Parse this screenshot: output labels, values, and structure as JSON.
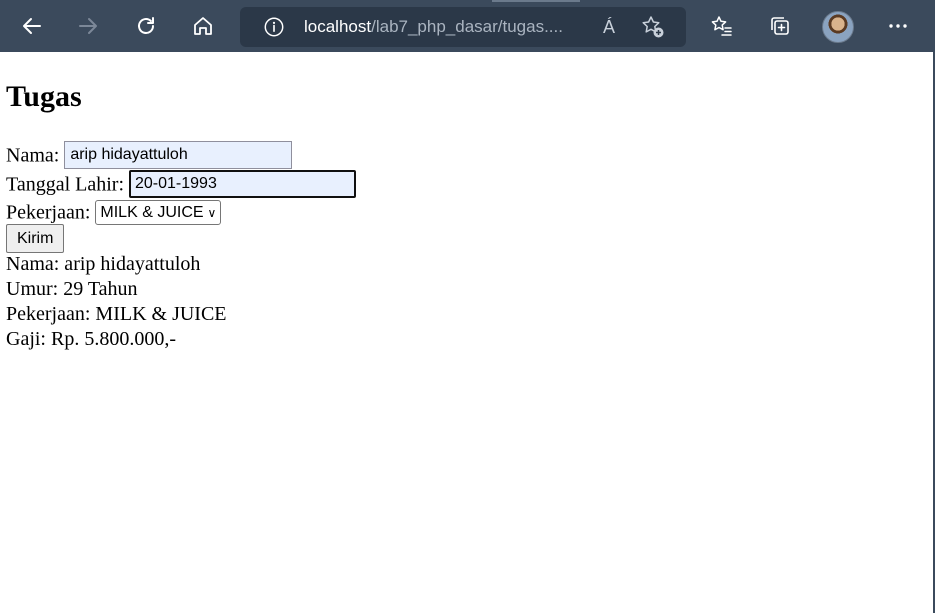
{
  "browser": {
    "address": {
      "host": "localhost",
      "path": "/lab7_php_dasar/tugas...."
    },
    "read_aloud_label": "Á"
  },
  "page": {
    "title": "Tugas",
    "form": {
      "nama_label": "Nama:",
      "nama_value": "arip hidayattuloh",
      "tanggal_label": "Tanggal Lahir:",
      "tanggal_value": "20-01-1993",
      "pekerjaan_label": "Pekerjaan:",
      "pekerjaan_value": "MILK & JUICE",
      "submit_label": "Kirim"
    },
    "result": {
      "nama": "Nama: arip hidayattuloh",
      "umur": "Umur: 29 Tahun",
      "pekerjaan": "Pekerjaan: MILK & JUICE",
      "gaji": "Gaji: Rp. 5.800.000,-"
    }
  }
}
